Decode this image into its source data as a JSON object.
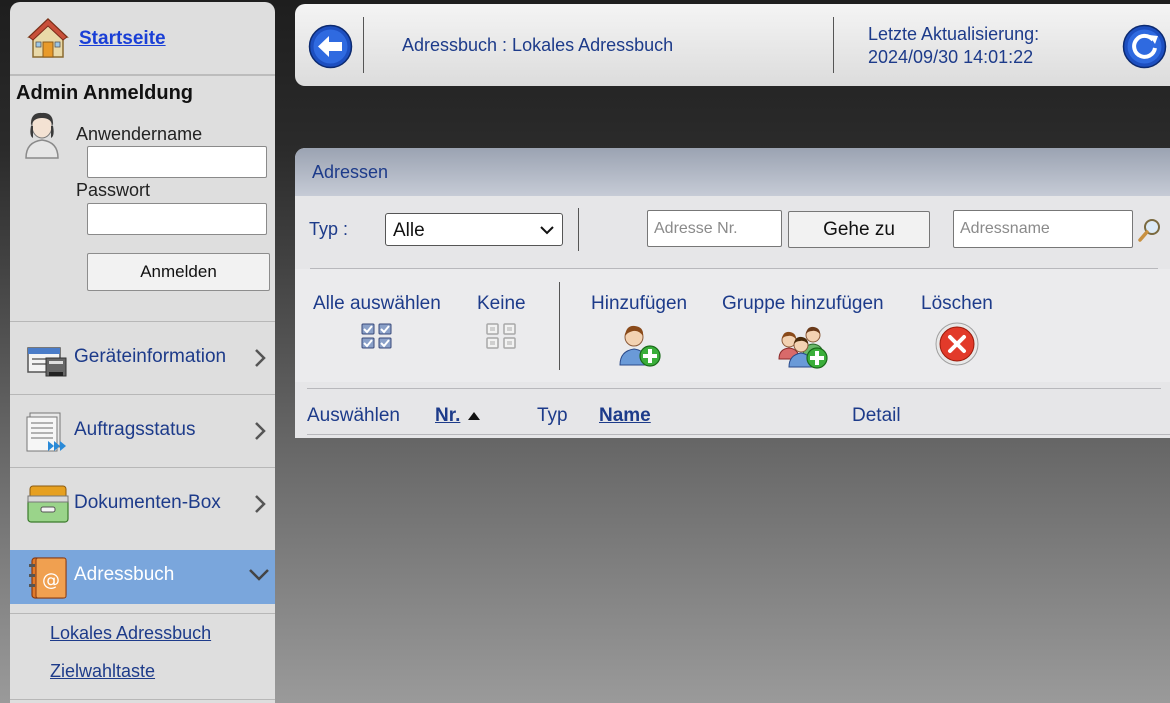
{
  "sidebar": {
    "home_label": "Startseite",
    "admin_title": "Admin Anmeldung",
    "username_label": "Anwendername",
    "password_label": "Passwort",
    "username_value": "",
    "password_value": "",
    "login_button": "Anmelden",
    "nav": [
      {
        "label": "Geräteinformation",
        "icon": "device-info-icon",
        "expanded": false
      },
      {
        "label": "Auftragsstatus",
        "icon": "job-status-icon",
        "expanded": false
      },
      {
        "label": "Dokumenten-Box",
        "icon": "document-box-icon",
        "expanded": false
      },
      {
        "label": "Adressbuch",
        "icon": "address-book-icon",
        "expanded": true,
        "active": true
      }
    ],
    "sub_items": [
      "Lokales Adressbuch",
      "Zielwahltaste"
    ]
  },
  "topbar": {
    "title": "Adressbuch : Lokales Adressbuch",
    "update_label": "Letzte Aktualisierung:",
    "update_time": "2024/09/30 14:01:22"
  },
  "panel": {
    "title": "Adressen",
    "type_label": "Typ :",
    "type_selected": "Alle",
    "address_nr_placeholder": "Adresse Nr.",
    "goto_button": "Gehe zu",
    "address_name_placeholder": "Adressname",
    "actions": {
      "select_all": "Alle auswählen",
      "none": "Keine",
      "add": "Hinzufügen",
      "add_group": "Gruppe hinzufügen",
      "delete": "Löschen"
    },
    "columns": {
      "select": "Auswählen",
      "nr": "Nr.",
      "type": "Typ",
      "name": "Name",
      "detail": "Detail"
    },
    "sort_column": "Nr.",
    "sort_direction": "ascending"
  },
  "colors": {
    "link_blue": "#1a3fd6",
    "text_blue": "#1d3b8a",
    "active_nav": "#7aa6dc",
    "delete_red": "#e23a2a",
    "add_green": "#3aae3a"
  }
}
